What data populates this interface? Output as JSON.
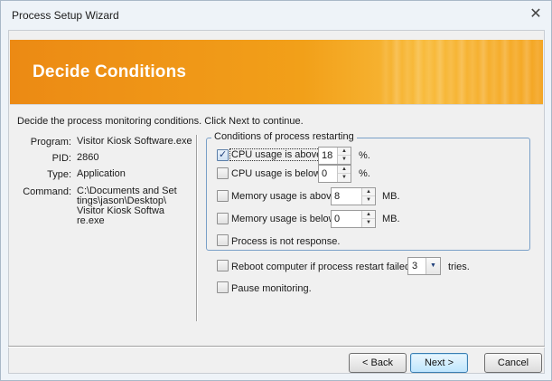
{
  "window": {
    "title": "Process Setup Wizard",
    "close_glyph": "✕"
  },
  "banner": {
    "title": "Decide Conditions"
  },
  "instruction": "Decide the process monitoring conditions. Click Next to continue.",
  "info": [
    {
      "label": "Program:",
      "value": "Visitor Kiosk Software.exe"
    },
    {
      "label": "PID:",
      "value": "2860"
    },
    {
      "label": "Type:",
      "value": "Application"
    },
    {
      "label": "Command:",
      "value_lines": [
        "C:\\Documents and Set",
        "tings\\jason\\Desktop\\",
        "Visitor Kiosk Softwa",
        "re.exe"
      ]
    }
  ],
  "conditions_group": {
    "legend": "Conditions of process restarting",
    "items": [
      {
        "label": "CPU usage is above",
        "checked": true,
        "value": "18",
        "unit": "%."
      },
      {
        "label": "CPU usage is below",
        "checked": false,
        "value": "0",
        "unit": "%."
      },
      {
        "label": "Memory usage is above",
        "checked": false,
        "value": "8",
        "unit": "MB."
      },
      {
        "label": "Memory usage is below",
        "checked": false,
        "value": "0",
        "unit": "MB."
      },
      {
        "label": "Process is not response.",
        "checked": false
      }
    ]
  },
  "reboot": {
    "label": "Reboot computer if process restart failed for",
    "checked": false,
    "value": "3",
    "suffix": "tries."
  },
  "pause": {
    "label": "Pause monitoring.",
    "checked": false
  },
  "buttons": {
    "back": {
      "label": "< Back",
      "mnemonic": "B"
    },
    "next": {
      "label": "Next >",
      "mnemonic": "N"
    },
    "cancel": {
      "label": "Cancel"
    }
  },
  "colors": {
    "banner_start": "#ec8a14",
    "banner_end": "#f8bb3c",
    "group_border": "#7aa0c8"
  },
  "icons": {
    "close": "close-icon",
    "spin_up": "spin-up-icon",
    "spin_down": "spin-down-icon",
    "dropdown": "chevron-down-icon",
    "check": "checkmark-icon"
  }
}
